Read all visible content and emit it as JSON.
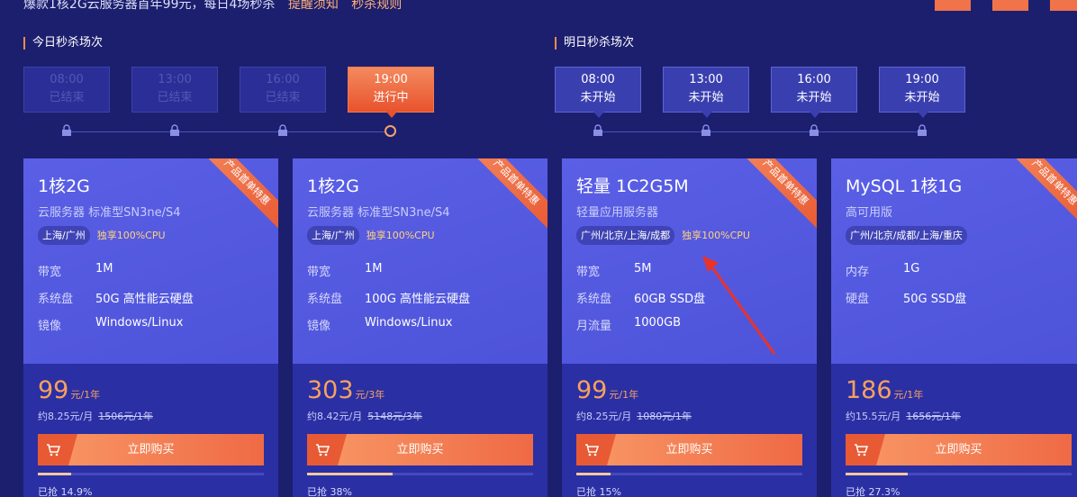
{
  "banner": {
    "text": "爆款1核2G云服务器首年99元，每日4场秒杀",
    "link1": "提醒须知",
    "link2": "秒杀规则"
  },
  "today": {
    "title": "今日秒杀场次",
    "slots": [
      {
        "time": "08:00",
        "status": "已结束"
      },
      {
        "time": "13:00",
        "status": "已结束"
      },
      {
        "time": "16:00",
        "status": "已结束"
      },
      {
        "time": "19:00",
        "status": "进行中"
      }
    ]
  },
  "tomorrow": {
    "title": "明日秒杀场次",
    "slots": [
      {
        "time": "08:00",
        "status": "未开始"
      },
      {
        "time": "13:00",
        "status": "未开始"
      },
      {
        "time": "16:00",
        "status": "未开始"
      },
      {
        "time": "19:00",
        "status": "未开始"
      }
    ]
  },
  "ribbon_text": "产品首单特惠",
  "buy_label": "立即购买",
  "cards": [
    {
      "title": "1核2G",
      "subtitle": "云服务器 标准型SN3ne/S4",
      "region": "上海/广州",
      "cpu": "独享100%CPU",
      "specs": [
        {
          "key": "带宽",
          "val": "1M"
        },
        {
          "key": "系统盘",
          "val": "50G 高性能云硬盘"
        },
        {
          "key": "镜像",
          "val": "Windows/Linux"
        }
      ],
      "price": "99",
      "unit": "元/1年",
      "monthly": "约8.25元/月",
      "original": "1506元/1年",
      "progress": 0.149,
      "sold": "已抢 14.9%"
    },
    {
      "title": "1核2G",
      "subtitle": "云服务器 标准型SN3ne/S4",
      "region": "上海/广州",
      "cpu": "独享100%CPU",
      "specs": [
        {
          "key": "带宽",
          "val": "1M"
        },
        {
          "key": "系统盘",
          "val": "100G 高性能云硬盘"
        },
        {
          "key": "镜像",
          "val": "Windows/Linux"
        }
      ],
      "price": "303",
      "unit": "元/3年",
      "monthly": "约8.42元/月",
      "original": "5148元/3年",
      "progress": 0.38,
      "sold": "已抢 38%"
    },
    {
      "title": "轻量 1C2G5M",
      "subtitle": "轻量应用服务器",
      "region": "广州/北京/上海/成都",
      "cpu": "独享100%CPU",
      "specs": [
        {
          "key": "带宽",
          "val": "5M"
        },
        {
          "key": "系统盘",
          "val": "60GB SSD盘"
        },
        {
          "key": "月流量",
          "val": "1000GB"
        }
      ],
      "price": "99",
      "unit": "元/1年",
      "monthly": "约8.25元/月",
      "original": "1080元/1年",
      "progress": 0.15,
      "sold": "已抢 15%"
    },
    {
      "title": "MySQL 1核1G",
      "subtitle": "高可用版",
      "region": "广州/北京/成都/上海/重庆",
      "cpu": "",
      "specs": [
        {
          "key": "内存",
          "val": "1G"
        },
        {
          "key": "硬盘",
          "val": "50G SSD盘"
        }
      ],
      "price": "186",
      "unit": "元/1年",
      "monthly": "约15.5元/月",
      "original": "1656元/1年",
      "progress": 0.273,
      "sold": "已抢 27.3%"
    }
  ]
}
